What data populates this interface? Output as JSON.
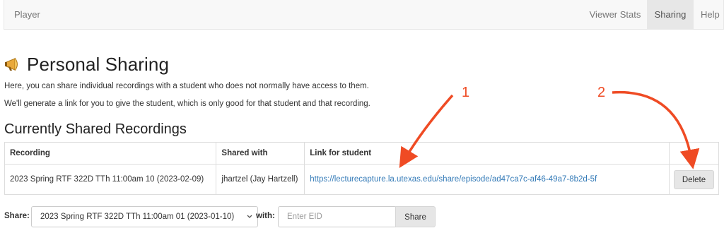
{
  "navbar": {
    "brand": "Player",
    "items": [
      {
        "label": "Viewer Stats",
        "active": false
      },
      {
        "label": "Sharing",
        "active": true
      },
      {
        "label": "Help",
        "active": false
      }
    ]
  },
  "page": {
    "title": "Personal Sharing",
    "title_icon": "megaphone-icon",
    "intro_1": "Here, you can share individual recordings with a student who does not normally have access to them.",
    "intro_2": "We'll generate a link for you to give the student, which is only good for that student and that recording."
  },
  "shared": {
    "heading": "Currently Shared Recordings",
    "columns": [
      "Recording",
      "Shared with",
      "Link for student",
      ""
    ],
    "rows": [
      {
        "recording": "2023 Spring RTF 322D TTh 11:00am 10 (2023-02-09)",
        "shared_with": "jhartzel (Jay Hartzell)",
        "link": "https://lecturecapture.la.utexas.edu/share/episode/ad47ca7c-af46-49a7-8b2d-5f",
        "action": "Delete"
      }
    ]
  },
  "form": {
    "share_label": "Share:",
    "selected_recording": "2023 Spring RTF 322D TTh 11:00am 01 (2023-01-10)",
    "with_label": "with:",
    "eid_placeholder": "Enter EID",
    "eid_value": "",
    "share_button": "Share"
  },
  "annotations": {
    "label_1": "1",
    "label_2": "2",
    "color": "#ef4b24"
  }
}
